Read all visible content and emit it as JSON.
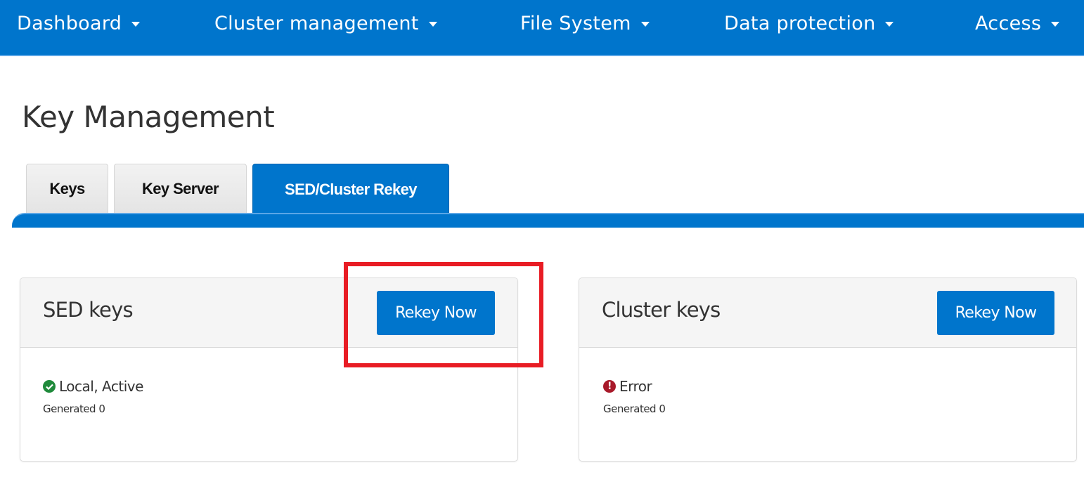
{
  "nav": {
    "items": [
      {
        "label": "Dashboard"
      },
      {
        "label": "Cluster management"
      },
      {
        "label": "File System"
      },
      {
        "label": "Data protection"
      },
      {
        "label": "Access"
      }
    ]
  },
  "page": {
    "title": "Key Management"
  },
  "tabs": [
    {
      "label": "Keys",
      "active": false
    },
    {
      "label": "Key Server",
      "active": false
    },
    {
      "label": "SED/Cluster Rekey",
      "active": true
    }
  ],
  "panels": {
    "sed": {
      "title": "SED keys",
      "button_label": "Rekey Now",
      "status": "Local, Active",
      "status_icon": "check-circle-icon",
      "generated": "Generated 0"
    },
    "cluster": {
      "title": "Cluster keys",
      "button_label": "Rekey Now",
      "status": "Error",
      "status_icon": "exclamation-circle-icon",
      "generated": "Generated 0"
    }
  },
  "colors": {
    "brand": "#0075cc",
    "success": "#1f8a3b",
    "error": "#a8192a",
    "highlight": "#e81c24"
  }
}
